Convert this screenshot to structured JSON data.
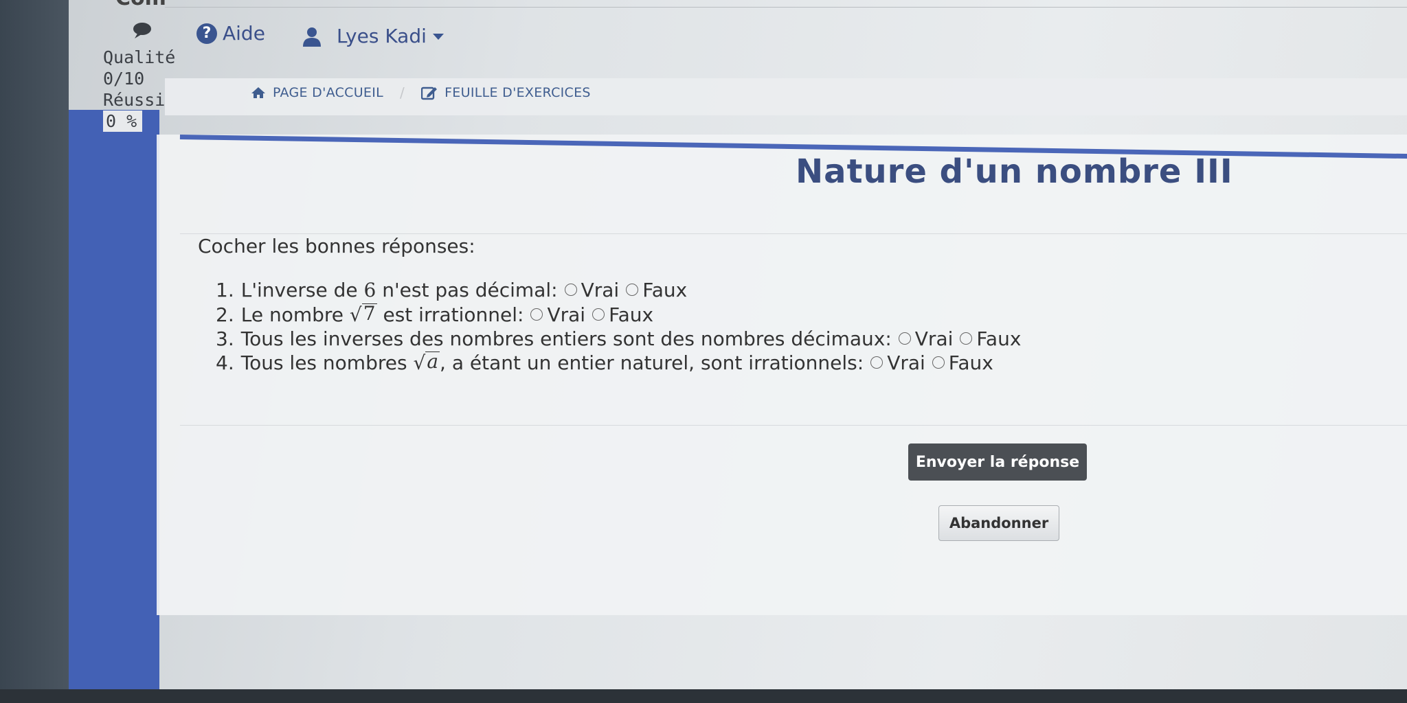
{
  "header": {
    "help_label": "Aide",
    "user_name": "Lyes Kadi",
    "cut_text": "Com"
  },
  "stats": {
    "quality_label": "Qualité",
    "quality_value": "0/10",
    "success_label": "Réussi",
    "success_value": "0 %"
  },
  "breadcrumb": {
    "home": "PAGE D'ACCUEIL",
    "separator": "/",
    "exercises": "FEUILLE D'EXERCICES"
  },
  "exercise": {
    "title": "Nature d'un nombre III",
    "instruction": "Cocher les bonnes réponses:",
    "option_true": "Vrai",
    "option_false": "Faux",
    "questions": [
      {
        "num": "1.",
        "before": "L'inverse de ",
        "math": "6",
        "after": " n'est pas décimal:"
      },
      {
        "num": "2.",
        "before": "Le nombre ",
        "radicand": "7",
        "after": " est irrationnel:"
      },
      {
        "num": "3.",
        "text": "Tous les inverses des nombres entiers sont des nombres décimaux:"
      },
      {
        "num": "4.",
        "before": "Tous les nombres ",
        "radicand": "a",
        "after": ", a étant un entier naturel, sont irrationnels:"
      }
    ]
  },
  "actions": {
    "submit": "Envoyer la réponse",
    "abandon": "Abandonner"
  },
  "colors": {
    "accent": "#4361b5",
    "title": "#3b4e80",
    "submit_bg": "#4b4f54"
  }
}
